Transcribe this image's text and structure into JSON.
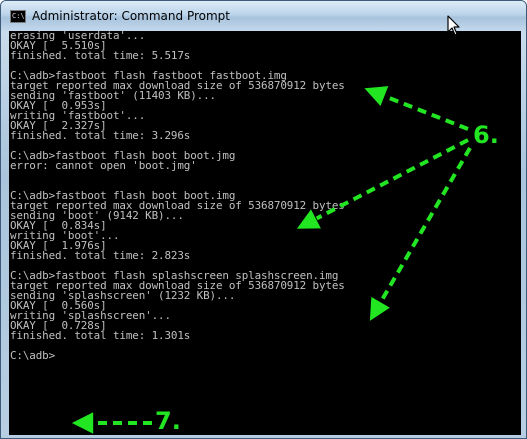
{
  "window": {
    "title": "Administrator: Command Prompt",
    "icon_text": "C:\\"
  },
  "console": {
    "lines": [
      "erasing 'userdata'...",
      "OKAY [  5.510s]",
      "finished. total time: 5.517s",
      "",
      "C:\\adb>fastboot flash fastboot fastboot.img",
      "target reported max download size of 536870912 bytes",
      "sending 'fastboot' (11403 KB)...",
      "OKAY [  0.953s]",
      "writing 'fastboot'...",
      "OKAY [  2.327s]",
      "finished. total time: 3.296s",
      "",
      "C:\\adb>fastboot flash boot boot.jmg",
      "error: cannot open 'boot.jmg'",
      "",
      "",
      "C:\\adb>fastboot flash boot boot.img",
      "target reported max download size of 536870912 bytes",
      "sending 'boot' (9142 KB)...",
      "OKAY [  0.834s]",
      "writing 'boot'...",
      "OKAY [  1.976s]",
      "finished. total time: 2.823s",
      "",
      "C:\\adb>fastboot flash splashscreen splashscreen.img",
      "target reported max download size of 536870912 bytes",
      "sending 'splashscreen' (1232 KB)...",
      "OKAY [  0.560s]",
      "writing 'splashscreen'...",
      "OKAY [  0.728s]",
      "finished. total time: 1.301s",
      "",
      "C:\\adb>"
    ]
  },
  "annotations": {
    "label_6": "6.",
    "label_7": "7.",
    "arrow_color": "#22e622"
  }
}
